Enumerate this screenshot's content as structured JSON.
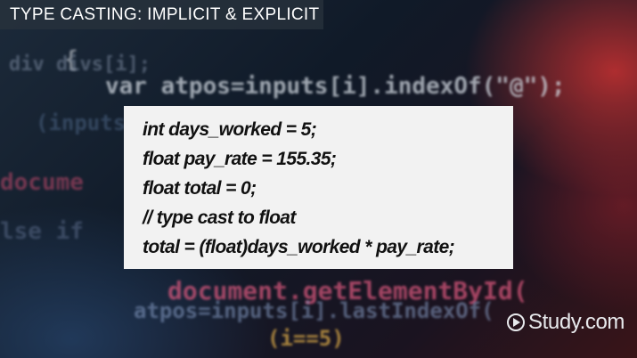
{
  "banner": {
    "title": "TYPE CASTING: IMPLICIT & EXPLICIT"
  },
  "code_block": {
    "lines": [
      "int days_worked = 5;",
      "float pay_rate = 155.35;",
      "float total = 0;",
      "// type cast to float",
      "total = (float)days_worked * pay_rate;"
    ]
  },
  "background_code": [
    "{",
    "div  divs[i];",
    "var atpos=inputs[i].indexOf(\"@\");",
    "(inputs[i]. lastIndexOf(\".\");",
    "docume",
    "lse if",
    "document.getElementById(",
    "atpos=inputs[i].lastIndexOf(",
    "(i==5)"
  ],
  "brand": {
    "icon": "play-circle-icon",
    "text": "Study.com"
  },
  "colors": {
    "banner_bg": "#28323c",
    "code_box_bg": "#f2f2f2",
    "code_text": "#111111"
  }
}
